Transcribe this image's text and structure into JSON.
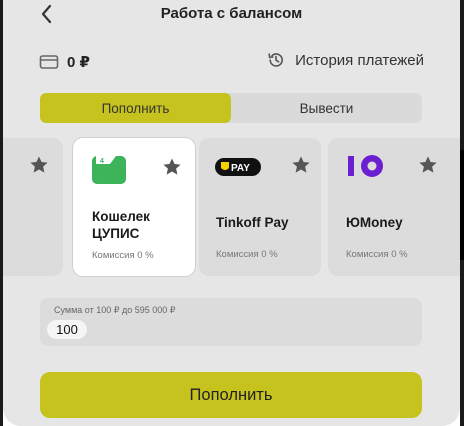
{
  "header": {
    "title": "Работа с балансом"
  },
  "balance": {
    "value": "0 ₽",
    "history_label": "История платежей"
  },
  "tabs": [
    {
      "label": "Пополнить",
      "active": true
    },
    {
      "label": "Вывести",
      "active": false
    }
  ],
  "methods": [
    {
      "name": "Кошелек ЦУПИС",
      "fee": "Комиссия 0 %",
      "selected": true,
      "logo": "cupis-wallet-logo"
    },
    {
      "name": "Tinkoff Pay",
      "fee": "Комиссия 0 %",
      "selected": false,
      "logo": "tinkoff-pay-logo",
      "logo_text": "PAY"
    },
    {
      "name": "ЮMoney",
      "fee": "Комиссия 0 %",
      "selected": false,
      "logo": "yoomoney-logo"
    }
  ],
  "amount": {
    "label": "Сумма от 100 ₽ до 595 000 ₽",
    "value": "100"
  },
  "submit_label": "Пополнить",
  "colors": {
    "accent": "#c6c31e",
    "background": "#e6e6e6",
    "card": "#dcdcdc",
    "cupis_green": "#3db35a",
    "yoomoney_purple": "#6b1fd0"
  }
}
